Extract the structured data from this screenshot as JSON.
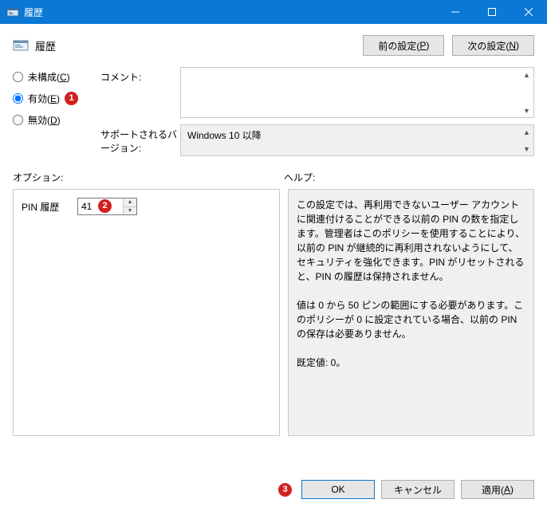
{
  "window": {
    "title": "履歴"
  },
  "header": {
    "policy_title": "履歴",
    "prev_setting_prefix": "前の設定(",
    "prev_setting_key": "P",
    "prev_setting_suffix": ")",
    "next_setting_prefix": "次の設定(",
    "next_setting_key": "N",
    "next_setting_suffix": ")"
  },
  "state": {
    "not_configured_prefix": "未構成(",
    "not_configured_key": "C",
    "not_configured_suffix": ")",
    "enabled_prefix": "有効(",
    "enabled_key": "E",
    "enabled_suffix": ")",
    "disabled_prefix": "無効(",
    "disabled_key": "D",
    "disabled_suffix": ")"
  },
  "fields": {
    "comment_label": "コメント:",
    "comment_value": "",
    "supported_label": "サポートされるバージョン:",
    "supported_value": "Windows 10 以降"
  },
  "sections": {
    "options_label": "オプション:",
    "help_label": "ヘルプ:"
  },
  "options": {
    "pin_history_label": "PIN 履歴",
    "pin_history_value": "41"
  },
  "help": {
    "text": "この設定では、再利用できないユーザー アカウントに関連付けることができる以前の PIN の数を指定します。管理者はこのポリシーを使用することにより、以前の PIN が継続的に再利用されないようにして、セキュリティを強化できます。PIN がリセットされると、PIN の履歴は保持されません。\n\n値は 0 から 50 ピンの範囲にする必要があります。このポリシーが 0 に設定されている場合、以前の PIN の保存は必要ありません。\n\n既定値: 0。"
  },
  "footer": {
    "ok": "OK",
    "cancel": "キャンセル",
    "apply_prefix": "適用(",
    "apply_key": "A",
    "apply_suffix": ")"
  },
  "badges": {
    "b1": "1",
    "b2": "2",
    "b3": "3"
  }
}
